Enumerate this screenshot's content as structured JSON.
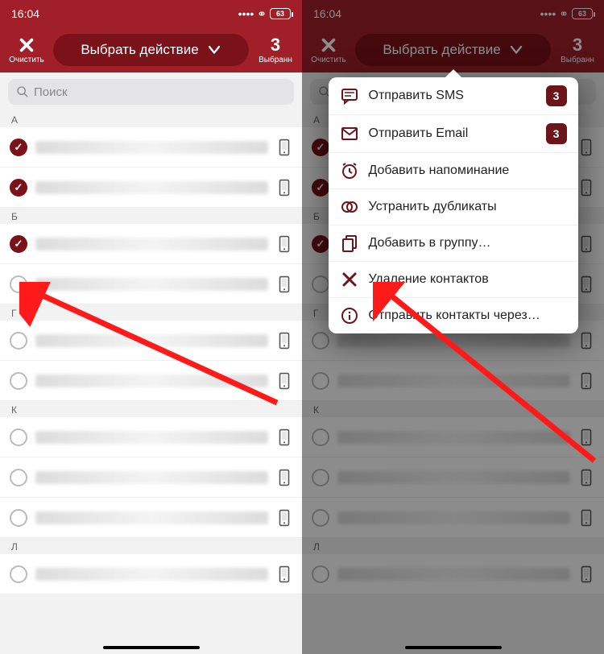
{
  "status": {
    "time": "16:04",
    "battery": "63"
  },
  "toolbar": {
    "clear_label": "Очистить",
    "action_label": "Выбрать действие",
    "selected_count": "3",
    "selected_label": "Выбранн"
  },
  "search": {
    "placeholder": "Поиск"
  },
  "sections": [
    {
      "letter": "А",
      "rows": [
        {
          "checked": true,
          "len": "long"
        },
        {
          "checked": true,
          "len": "med"
        }
      ]
    },
    {
      "letter": "Б",
      "rows": [
        {
          "checked": true,
          "len": "med"
        },
        {
          "checked": false,
          "len": "short"
        }
      ]
    },
    {
      "letter": "Г",
      "rows": [
        {
          "checked": false,
          "len": "med"
        },
        {
          "checked": false,
          "len": "med"
        }
      ]
    },
    {
      "letter": "К",
      "rows": [
        {
          "checked": false,
          "len": "long"
        },
        {
          "checked": false,
          "len": "med"
        },
        {
          "checked": false,
          "len": "short"
        }
      ]
    },
    {
      "letter": "Л",
      "rows": [
        {
          "checked": false,
          "len": "long"
        }
      ]
    }
  ],
  "popup": {
    "items": [
      {
        "icon": "sms",
        "label": "Отправить SMS",
        "badge": "3"
      },
      {
        "icon": "email",
        "label": "Отправить Email",
        "badge": "3"
      },
      {
        "icon": "alarm",
        "label": "Добавить напоминание"
      },
      {
        "icon": "dup",
        "label": "Устранить дубликаты"
      },
      {
        "icon": "group",
        "label": "Добавить в группу…"
      },
      {
        "icon": "delete",
        "label": "Удаление контактов"
      },
      {
        "icon": "info",
        "label": "Отправить контакты через…"
      }
    ]
  }
}
